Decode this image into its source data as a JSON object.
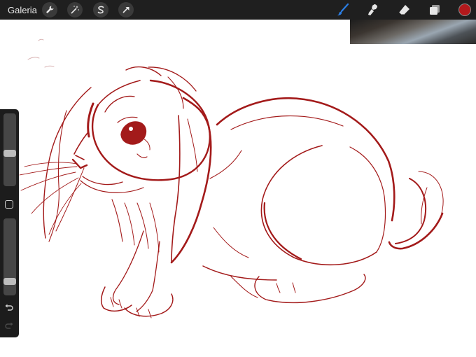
{
  "toolbar": {
    "gallery_label": "Galeria"
  },
  "brush_size": {
    "value": 0.45
  },
  "brush_opacity": {
    "value": 0.15
  },
  "colors": {
    "active_color": "#b3191c",
    "accent_blue": "#2b7fe6",
    "stroke": "#a31a1a"
  },
  "icons": [
    "wrench-icon",
    "magic-wand-icon",
    "selection-s-icon",
    "arrow-move-icon",
    "brush-icon",
    "smudge-icon",
    "eraser-icon",
    "layers-icon",
    "undo-icon",
    "redo-icon"
  ]
}
